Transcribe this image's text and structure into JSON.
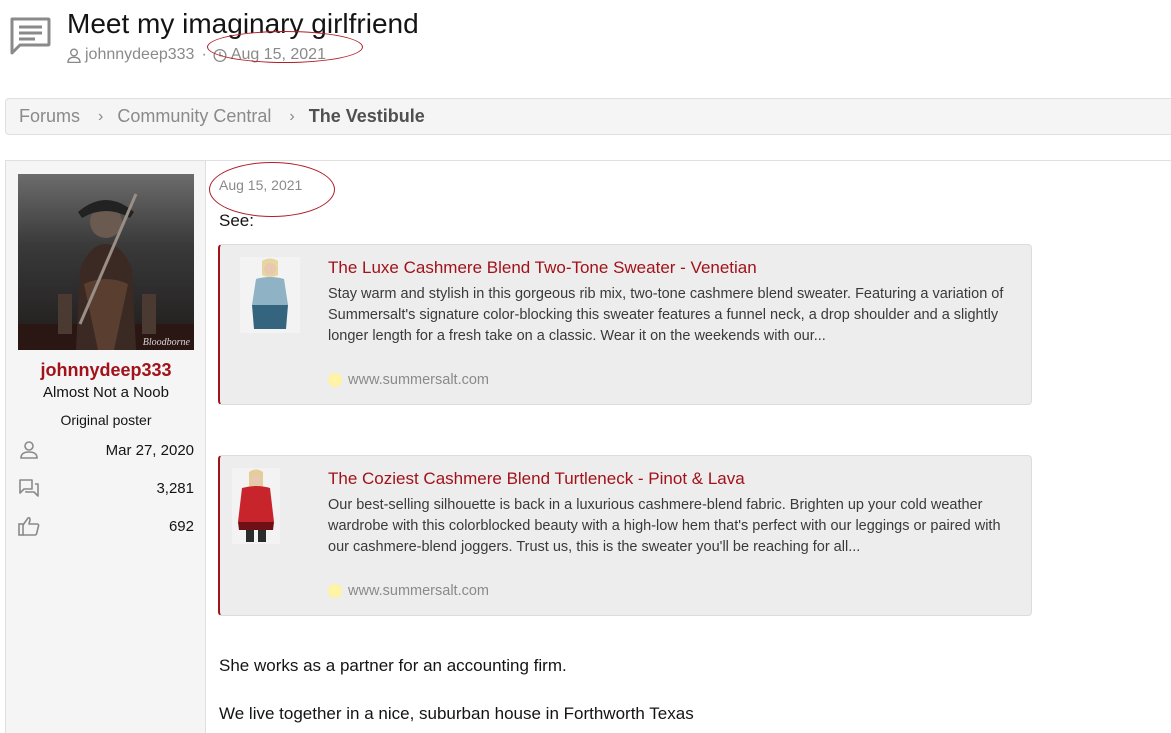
{
  "thread": {
    "title": "Meet my imaginary girlfriend",
    "author": "johnnydeep333",
    "separator": "·",
    "date": "Aug 15, 2021"
  },
  "breadcrumb": {
    "items": [
      "Forums",
      "Community Central",
      "The Vestibule"
    ],
    "chevron": "›"
  },
  "user": {
    "name": "johnnydeep333",
    "title": "Almost Not a Noob",
    "badge": "Original poster",
    "joined": "Mar 27, 2020",
    "messages": "3,281",
    "reactions": "692",
    "avatar_watermark": "Bloodborne"
  },
  "post": {
    "date": "Aug 15, 2021",
    "intro": "See:",
    "links": [
      {
        "title": "The Luxe Cashmere Blend Two-Tone Sweater - Venetian",
        "description": "Stay warm and stylish in this gorgeous rib mix, two-tone cashmere blend sweater. Featuring a variation of Summersalt's signature color-blocking this sweater features a funnel neck, a drop shoulder and a slightly longer length for a fresh take on a classic. Wear it on the weekends with our...",
        "domain": "www.summersalt.com"
      },
      {
        "title": "The Coziest Cashmere Blend Turtleneck - Pinot & Lava",
        "description": "Our best-selling silhouette is back in a luxurious cashmere-blend fabric. Brighten up your cold weather wardrobe with this colorblocked beauty with a high-low hem that's perfect with our leggings or paired with our cashmere-blend joggers. Trust us, this is the sweater you'll be reaching for all...",
        "domain": "www.summersalt.com"
      }
    ],
    "lines": [
      "She works as a partner for an accounting firm.",
      "We live together in a nice, suburban house in Forthworth Texas"
    ]
  },
  "colors": {
    "accent": "#a1121a",
    "muted": "#8a8a8a",
    "annotation": "#b01e28"
  },
  "icons": {
    "thread": "chat-bubble-icon",
    "author": "user-icon",
    "date": "clock-icon",
    "joined": "user-icon",
    "messages": "messages-icon",
    "reactions": "thumbs-up-icon"
  }
}
